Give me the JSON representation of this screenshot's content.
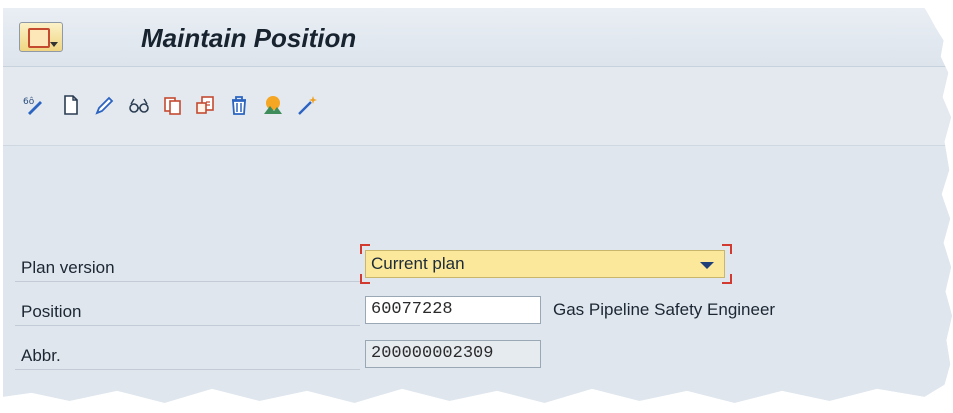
{
  "header": {
    "title": "Maintain Position",
    "menu_icon": "sap-menu-icon"
  },
  "toolbar": {
    "tools": [
      {
        "name": "other-object-icon"
      },
      {
        "name": "create-icon"
      },
      {
        "name": "change-pencil-icon"
      },
      {
        "name": "display-glasses-icon"
      },
      {
        "name": "copy-icon"
      },
      {
        "name": "delimit-icon"
      },
      {
        "name": "delete-trash-icon"
      },
      {
        "name": "overview-icon"
      },
      {
        "name": "wand-icon"
      }
    ]
  },
  "form": {
    "plan_version": {
      "label": "Plan version",
      "value": "Current plan"
    },
    "position": {
      "label": "Position",
      "value": "60077228",
      "description": "Gas Pipeline Safety Engineer"
    },
    "abbr": {
      "label": "Abbr.",
      "value": "200000002309"
    }
  }
}
